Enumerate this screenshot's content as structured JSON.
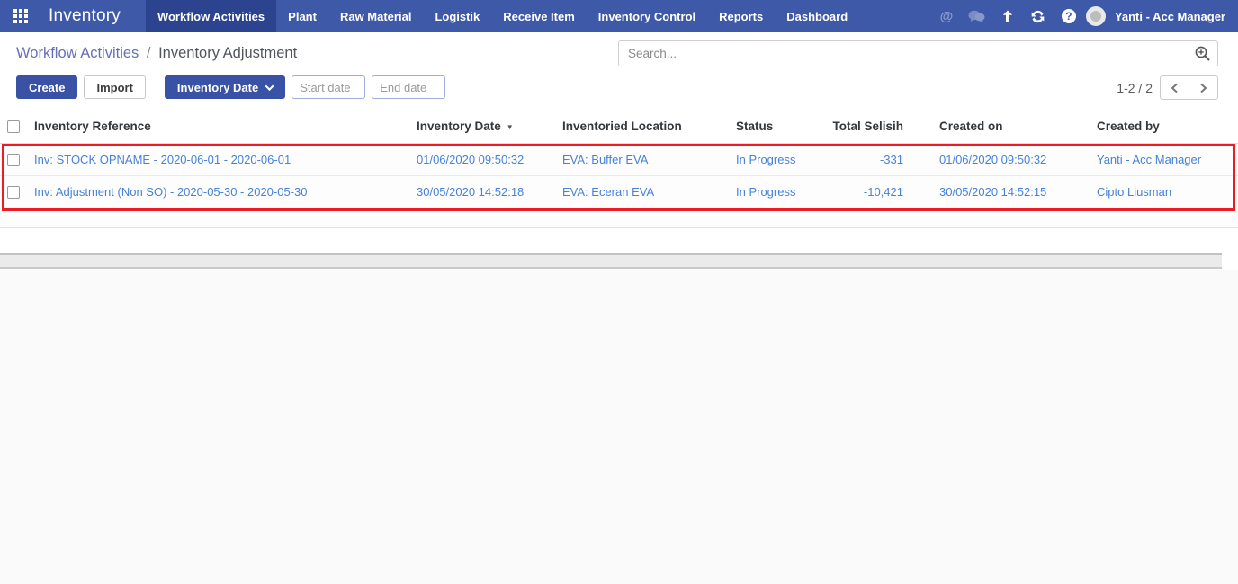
{
  "navbar": {
    "brand": "Inventory",
    "items": [
      {
        "label": "Workflow Activities",
        "active": true
      },
      {
        "label": "Plant",
        "active": false
      },
      {
        "label": "Raw Material",
        "active": false
      },
      {
        "label": "Logistik",
        "active": false
      },
      {
        "label": "Receive Item",
        "active": false
      },
      {
        "label": "Inventory Control",
        "active": false
      },
      {
        "label": "Reports",
        "active": false
      },
      {
        "label": "Dashboard",
        "active": false
      }
    ],
    "user": "Yanti - Acc Manager"
  },
  "icons": {
    "at_symbol": "@",
    "question_mark": "?",
    "sort_desc": "▼"
  },
  "breadcrumb": {
    "parent": "Workflow Activities",
    "separator": "/",
    "current": "Inventory Adjustment"
  },
  "search": {
    "placeholder": "Search..."
  },
  "toolbar": {
    "create_label": "Create",
    "import_label": "Import",
    "filter_label": "Inventory Date",
    "start_date_placeholder": "Start date",
    "end_date_placeholder": "End date"
  },
  "pager": {
    "range": "1-2 / 2"
  },
  "table": {
    "columns": {
      "reference": "Inventory Reference",
      "inventory_date": "Inventory Date",
      "location": "Inventoried Location",
      "status": "Status",
      "total_selisih": "Total Selisih",
      "created_on": "Created on",
      "created_by": "Created by"
    },
    "sort": {
      "column": "Inventory Date",
      "direction": "desc"
    },
    "rows": [
      {
        "reference": "Inv: STOCK OPNAME - 2020-06-01 - 2020-06-01",
        "inventory_date": "01/06/2020 09:50:32",
        "location": "EVA: Buffer EVA",
        "status": "In Progress",
        "total_selisih": "-331",
        "created_on": "01/06/2020 09:50:32",
        "created_by": "Yanti - Acc Manager"
      },
      {
        "reference": "Inv: Adjustment (Non SO) - 2020-05-30 - 2020-05-30",
        "inventory_date": "30/05/2020 14:52:18",
        "location": "EVA: Eceran EVA",
        "status": "In Progress",
        "total_selisih": "-10,421",
        "created_on": "30/05/2020 14:52:15",
        "created_by": "Cipto Liusman"
      }
    ]
  },
  "colors": {
    "navbar_bg": "#3e59a8",
    "navbar_active": "#2c4390",
    "accent": "#3a52a6",
    "row_link": "#4682d8",
    "breadcrumb_link": "#6670b8",
    "annotation_red": "#ec1c24"
  }
}
